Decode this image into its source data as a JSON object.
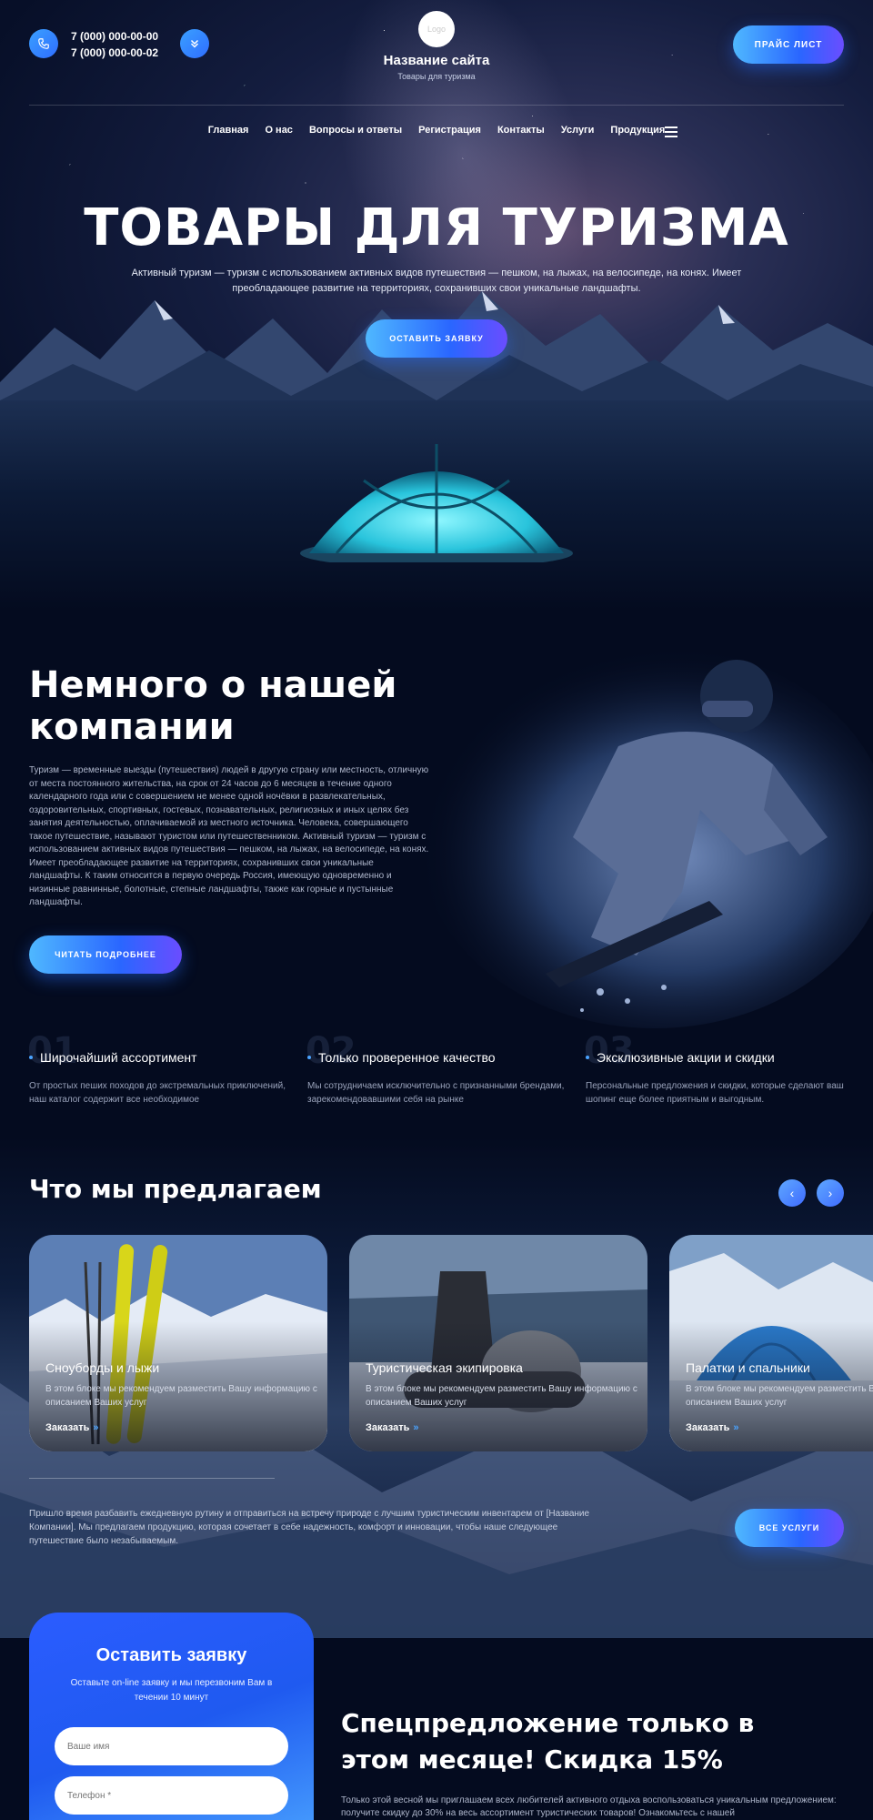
{
  "header": {
    "phones": [
      "7 (000) 000-00-00",
      "7 (000) 000-00-02"
    ],
    "logo_text": "Logo",
    "site_name": "Название сайта",
    "site_subtitle": "Товары для туризма",
    "price_button": "ПРАЙС ЛИСТ"
  },
  "nav": {
    "items": [
      "Главная",
      "О нас",
      "Вопросы и ответы",
      "Регистрация",
      "Контакты",
      "Услуги",
      "Продукция"
    ]
  },
  "hero": {
    "title": "ТОВАРЫ ДЛЯ ТУРИЗМА",
    "text": "Активный туризм — туризм с использованием активных видов путешествия — пешком, на лыжах, на велосипеде, на конях. Имеет преобладающее развитие на территориях, сохранивших свои уникальные ландшафты.",
    "cta": "ОСТАВИТЬ ЗАЯВКУ"
  },
  "about": {
    "title": "Немного о нашей компании",
    "text": "Туризм — временные выезды (путешествия) людей в другую страну или местность, отличную от места постоянного жительства, на срок от 24 часов до 6 месяцев в течение одного календарного года или с совершением не менее одной ночёвки в развлекательных, оздоровительных, спортивных, гостевых, познавательных, религиозных и иных целях без занятия деятельностью, оплачиваемой из местного источника. Человека, совершающего такое путешествие, называют туристом или путешественником. Активный туризм — туризм с использованием активных видов путешествия — пешком, на лыжах, на велосипеде, на конях. Имеет преобладающее развитие на территориях, сохранивших свои уникальные ландшафты. К таким относится в первую очередь Россия, имеющую одновременно и низинные равнинные, болотные, степные ландшафты, также как горные и пустынные ландшафты.",
    "button": "ЧИТАТЬ ПОДРОБНЕЕ"
  },
  "features": [
    {
      "num": "01",
      "title": "Широчайший ассортимент",
      "text": "От простых пеших походов до экстремальных приключений, наш каталог содержит все необходимое"
    },
    {
      "num": "02",
      "title": "Только проверенное качество",
      "text": "Мы сотрудничаем исключительно с признанными брендами, зарекомендовавшими себя на рынке"
    },
    {
      "num": "03",
      "title": "Эксклюзивные акции и скидки",
      "text": "Персональные предложения и скидки, которые сделают ваш шопинг еще более приятным и выгодным."
    }
  ],
  "services": {
    "title": "Что мы предлагаем",
    "prev": "‹",
    "next": "›",
    "cards": [
      {
        "title": "Сноуборды и лыжи",
        "text": "В этом блоке мы рекомендуем разместить Вашу информацию с описанием Ваших услуг",
        "link": "Заказать"
      },
      {
        "title": "Туристическая экипировка",
        "text": "В этом блоке мы рекомендуем разместить Вашу информацию с описанием Ваших услуг",
        "link": "Заказать"
      },
      {
        "title": "Палатки и спальники",
        "text": "В этом блоке мы рекомендуем разместить Вашу информацию с описанием Ваших услуг",
        "link": "Заказать"
      }
    ],
    "text": "Пришло время разбавить ежедневную рутину и отправиться на встречу природе с лучшим туристическим инвентарем от [Название Компании]. Мы предлагаем продукцию, которая сочетает в себе надежность, комфорт и инновации, чтобы наше следующее путешествие было незабываемым.",
    "button": "ВСЕ УСЛУГИ"
  },
  "form": {
    "title": "Оставить заявку",
    "subtitle": "Оставьте on-line заявку и мы перезвоним Вам в течении 10 минут",
    "name_placeholder": "Ваше имя",
    "phone_placeholder": "Телефон *"
  },
  "offer": {
    "title": "Спецпредложение только в этом месяце! Скидка 15%",
    "text": "Только этой весной мы приглашаем всех любителей активного отдыха воспользоваться уникальным предложением: получите скидку до 30% на весь ассортимент туристических товаров! Ознакомьтесь с нашей"
  },
  "colors": {
    "accent": "#2f6dff",
    "accent_light": "#4fb8ff",
    "background": "#040b1f"
  },
  "icons": [
    "phone-icon",
    "chevrons-down-icon",
    "menu-icon",
    "arrow-left-icon",
    "arrow-right-icon",
    "double-chevron-right-icon"
  ]
}
